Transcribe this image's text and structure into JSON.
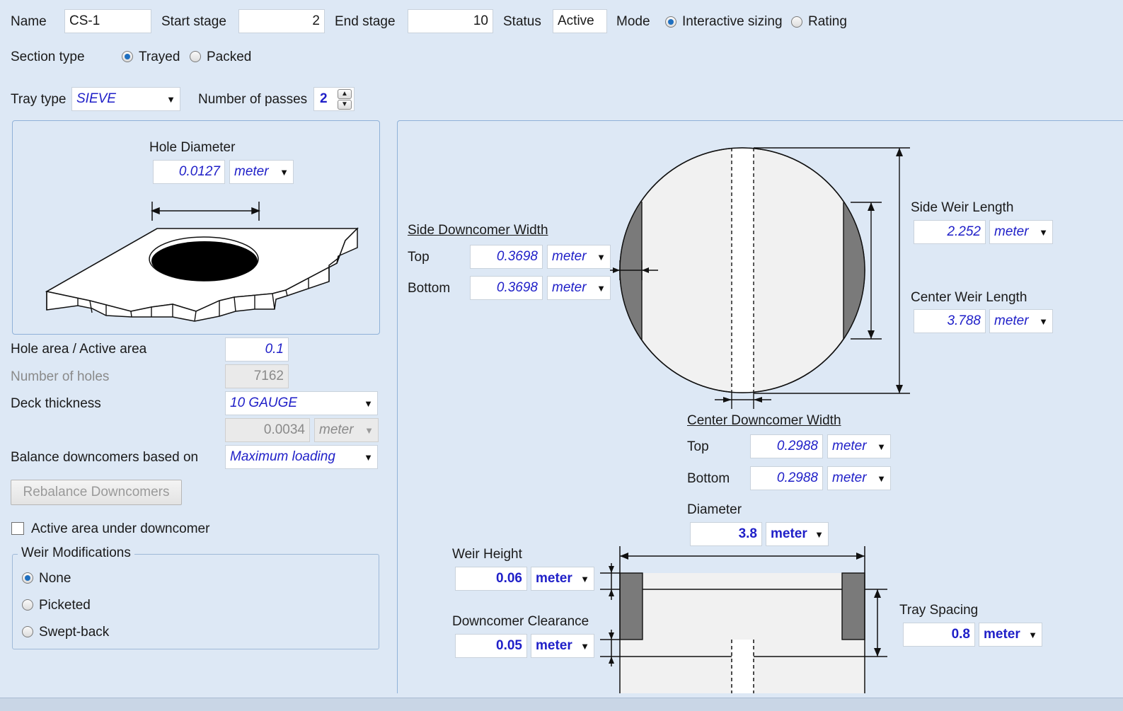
{
  "header": {
    "name_label": "Name",
    "name_value": "CS-1",
    "start_stage_label": "Start stage",
    "start_stage_value": "2",
    "end_stage_label": "End stage",
    "end_stage_value": "10",
    "status_label": "Status",
    "status_value": "Active",
    "mode_label": "Mode",
    "mode_options": [
      "Interactive sizing",
      "Rating"
    ],
    "mode_selected": "Interactive sizing"
  },
  "section_type": {
    "label": "Section type",
    "options": [
      "Trayed",
      "Packed"
    ],
    "selected": "Trayed"
  },
  "tray": {
    "type_label": "Tray type",
    "type_value": "SIEVE",
    "passes_label": "Number of passes",
    "passes_value": "2"
  },
  "hole": {
    "diameter_label": "Hole Diameter",
    "diameter_value": "0.0127",
    "diameter_unit": "meter"
  },
  "left_fields": {
    "hole_area_label": "Hole area / Active area",
    "hole_area_value": "0.1",
    "num_holes_label": "Number of holes",
    "num_holes_value": "7162",
    "deck_label": "Deck thickness",
    "deck_value": "10 GAUGE",
    "deck_thickness_value": "0.0034",
    "deck_thickness_unit": "meter",
    "balance_label": "Balance downcomers based on",
    "balance_value": "Maximum loading",
    "rebalance_button": "Rebalance Downcomers",
    "active_area_label": "Active area under downcomer",
    "active_area_checked": false
  },
  "weir_mods": {
    "title": "Weir Modifications",
    "options": [
      "None",
      "Picketed",
      "Swept-back"
    ],
    "selected": "None"
  },
  "side_downcomer": {
    "title": "Side Downcomer Width",
    "top_label": "Top",
    "top_value": "0.3698",
    "top_unit": "meter",
    "bottom_label": "Bottom",
    "bottom_value": "0.3698",
    "bottom_unit": "meter"
  },
  "side_weir": {
    "label": "Side Weir Length",
    "value": "2.252",
    "unit": "meter"
  },
  "center_weir": {
    "label": "Center Weir Length",
    "value": "3.788",
    "unit": "meter"
  },
  "center_downcomer": {
    "title": "Center Downcomer Width",
    "top_label": "Top",
    "top_value": "0.2988",
    "top_unit": "meter",
    "bottom_label": "Bottom",
    "bottom_value": "0.2988",
    "bottom_unit": "meter"
  },
  "diameter": {
    "label": "Diameter",
    "value": "3.8",
    "unit": "meter"
  },
  "weir_height": {
    "label": "Weir Height",
    "value": "0.06",
    "unit": "meter"
  },
  "downcomer_clearance": {
    "label": "Downcomer Clearance",
    "value": "0.05",
    "unit": "meter"
  },
  "tray_spacing": {
    "label": "Tray Spacing",
    "value": "0.8",
    "unit": "meter"
  },
  "colors": {
    "background": "#dde8f5",
    "value_text": "#1f1fc8",
    "accent": "#1e6fc0",
    "downcomer_fill": "#7a7a7a"
  }
}
